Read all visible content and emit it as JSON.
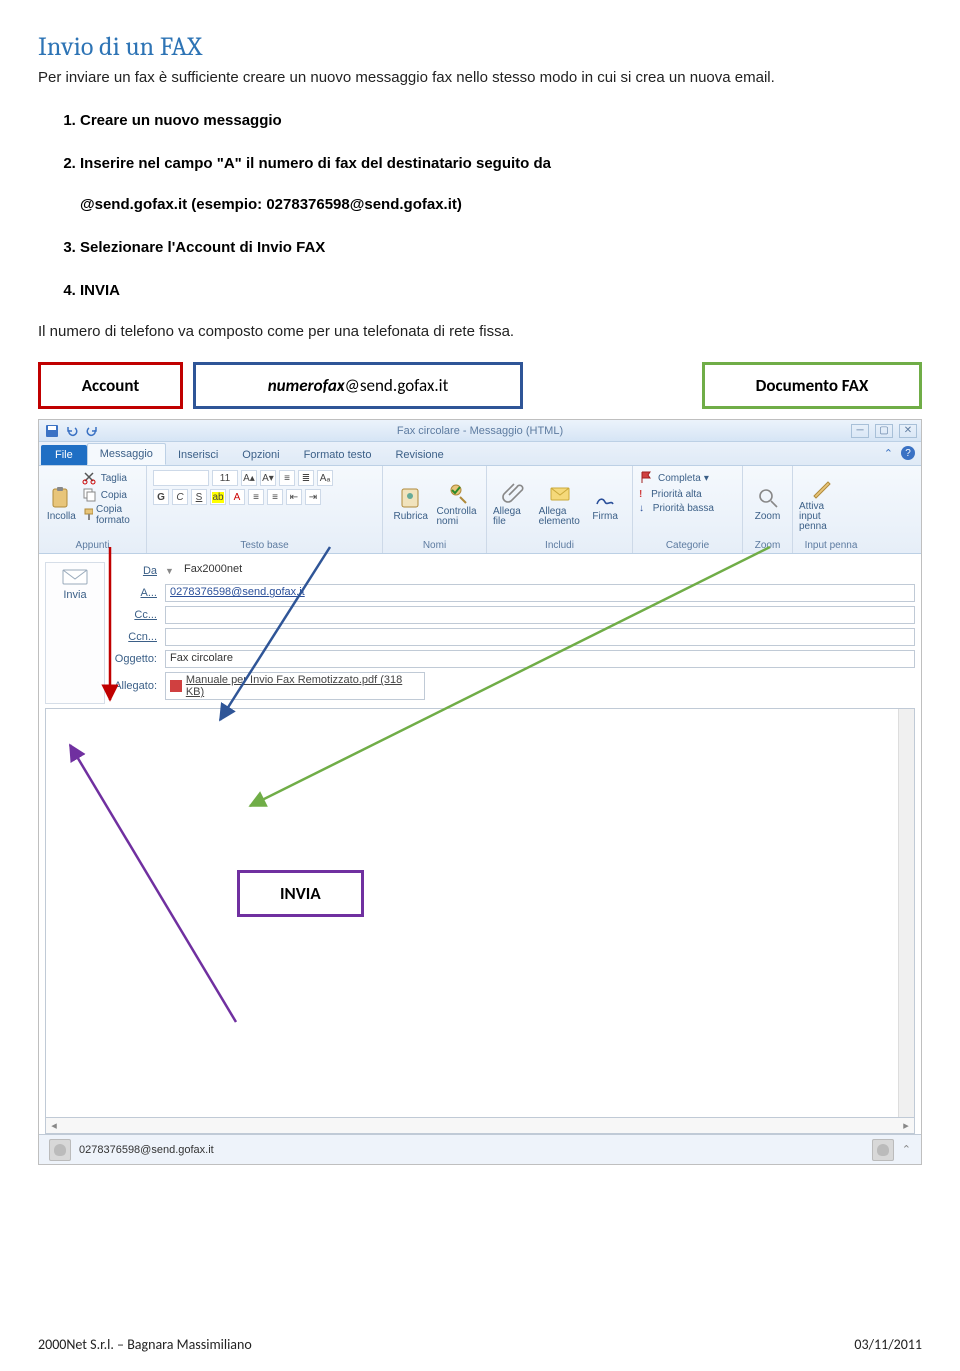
{
  "title": "Invio di un FAX",
  "intro": "Per inviare un fax è sufficiente creare un nuovo messaggio fax nello stesso modo in cui si crea un nuova email.",
  "steps": [
    {
      "text": "Creare un nuovo messaggio"
    },
    {
      "text": "Inserire nel campo \"A\" il numero di fax del destinatario seguito da",
      "sub": "@send.gofax.it  (esempio: 0278376598@send.gofax.it)"
    },
    {
      "text": "Selezionare l'Account di Invio FAX"
    },
    {
      "text": "INVIA"
    }
  ],
  "post": "Il numero di telefono va composto come per una telefonata di rete fissa.",
  "callouts": {
    "account": "Account",
    "fax_prefix": "numerofax",
    "fax_suffix": "@send.gofax.it",
    "documento": "Documento FAX",
    "invia": "INVIA"
  },
  "outlook": {
    "windowTitle": "Fax circolare - Messaggio (HTML)",
    "tabs": {
      "file": "File",
      "messaggio": "Messaggio",
      "inserisci": "Inserisci",
      "opzioni": "Opzioni",
      "formato": "Formato testo",
      "revisione": "Revisione"
    },
    "ribbon": {
      "clipboard": {
        "label": "Appunti",
        "paste": "Incolla",
        "cut": "Taglia",
        "copy": "Copia",
        "format": "Copia formato"
      },
      "font": {
        "label": "Testo base",
        "size": "11",
        "g": "G",
        "c": "C",
        "s": "S"
      },
      "names": {
        "label": "Nomi",
        "rubrica": "Rubrica",
        "controlla": "Controlla nomi"
      },
      "include": {
        "label": "Includi",
        "allegaFile": "Allega file",
        "allegaElem": "Allega elemento",
        "firma": "Firma"
      },
      "categorize": {
        "label": "Categorie",
        "completa": "Completa",
        "alta": "Priorità alta",
        "bassa": "Priorità bassa"
      },
      "zoom": {
        "label": "Zoom",
        "zoom": "Zoom"
      },
      "ink": {
        "label": "Input penna",
        "attiva": "Attiva input penna"
      }
    },
    "send": "Invia",
    "fields": {
      "da": "Da",
      "daVal": "Fax2000net",
      "a": "A...",
      "aVal": "0278376598@send.gofax.it",
      "cc": "Cc...",
      "ccn": "Ccn...",
      "oggetto": "Oggetto:",
      "oggVal": "Fax circolare",
      "allegato": "Allegato:",
      "allVal": "Manuale per Invio Fax Remotizzato.pdf (318 KB)"
    },
    "statusEmail": "0278376598@send.gofax.it"
  },
  "footer": {
    "left": "2000Net S.r.l. – Bagnara Massimiliano",
    "right": "03/11/2011"
  }
}
